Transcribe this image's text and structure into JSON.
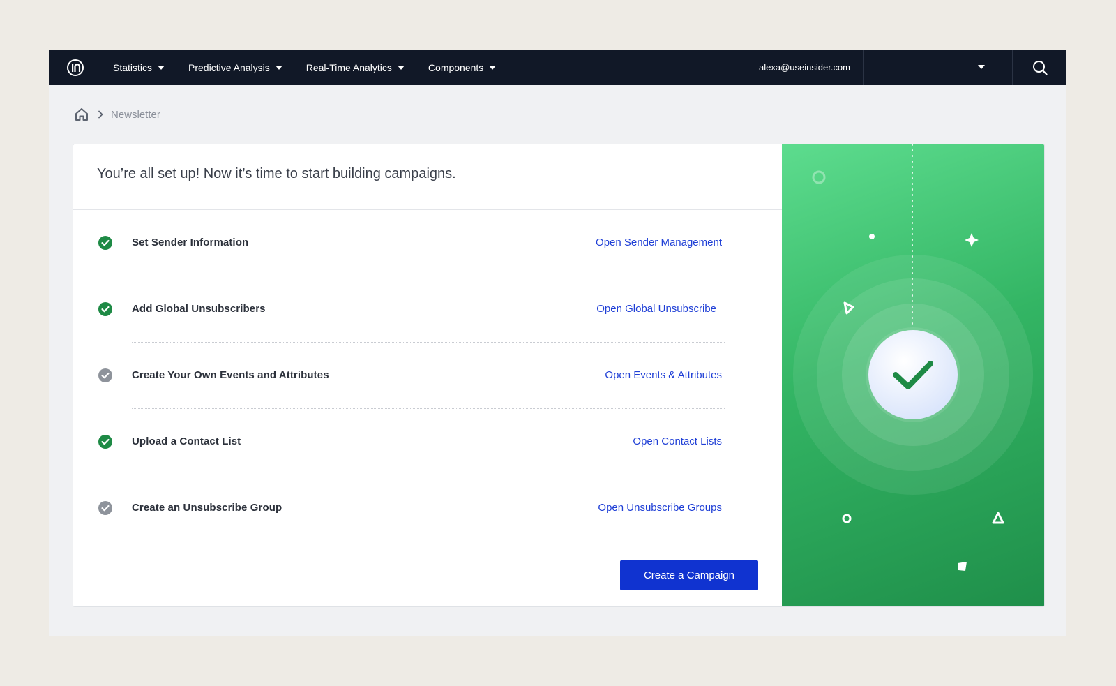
{
  "topbar": {
    "nav": [
      {
        "label": "Statistics"
      },
      {
        "label": "Predictive Analysis"
      },
      {
        "label": "Real-Time Analytics"
      },
      {
        "label": "Components"
      }
    ],
    "user_email": "alexa@useinsider.com",
    "icons": {
      "logo": "insider-logo-icon",
      "search": "search-icon",
      "caret": "caret-down-icon"
    }
  },
  "breadcrumb": {
    "home_icon": "home-icon",
    "separator_icon": "chevron-right-icon",
    "current": "Newsletter"
  },
  "card": {
    "title": "You’re all set up! Now it’s time to start building campaigns.",
    "steps": [
      {
        "label": "Set Sender Information",
        "link": "Open Sender Management",
        "status": "complete"
      },
      {
        "label": "Add Global Unsubscribers",
        "link": "Open Global Unsubscribe",
        "status": "complete"
      },
      {
        "label": "Create Your Own Events and Attributes",
        "link": "Open Events & Attributes",
        "status": "incomplete"
      },
      {
        "label": "Upload a Contact List",
        "link": "Open Contact Lists",
        "status": "complete"
      },
      {
        "label": "Create an Unsubscribe Group",
        "link": "Open Unsubscribe Groups",
        "status": "incomplete"
      }
    ],
    "cta_label": "Create a Campaign"
  },
  "colors": {
    "topbar": "#111827",
    "link": "#1f3fd6",
    "primary_button": "#1033d0",
    "complete": "#1e8a45",
    "incomplete": "#8e939b",
    "illustration_green": "#33b564"
  }
}
